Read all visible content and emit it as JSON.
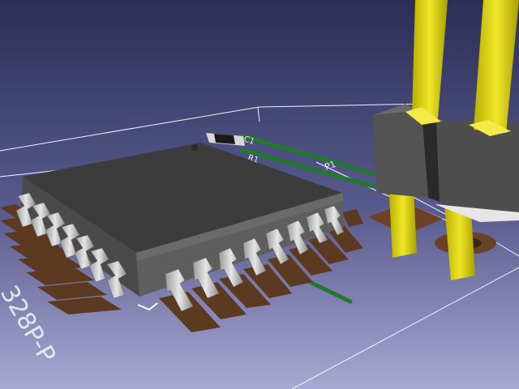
{
  "view": {
    "kind": "3D PCB render",
    "colors": {
      "background_top": "#3a3c66",
      "background_bottom": "#9a9ac8",
      "ic_body_top": "#3a3a3a",
      "ic_body_side": "#5a5a5a",
      "pins": "#c8c8c8",
      "pads": "#5a3a22",
      "header_pins": "#d8d020",
      "header_housing": "#4a4a4a",
      "traces": "#1f7a2a",
      "outline": "#ffffff"
    }
  },
  "silkscreen": {
    "bottom_left_text": "328P-P",
    "header_ref": "P1",
    "small_labels": [
      "C1",
      "R1"
    ]
  }
}
